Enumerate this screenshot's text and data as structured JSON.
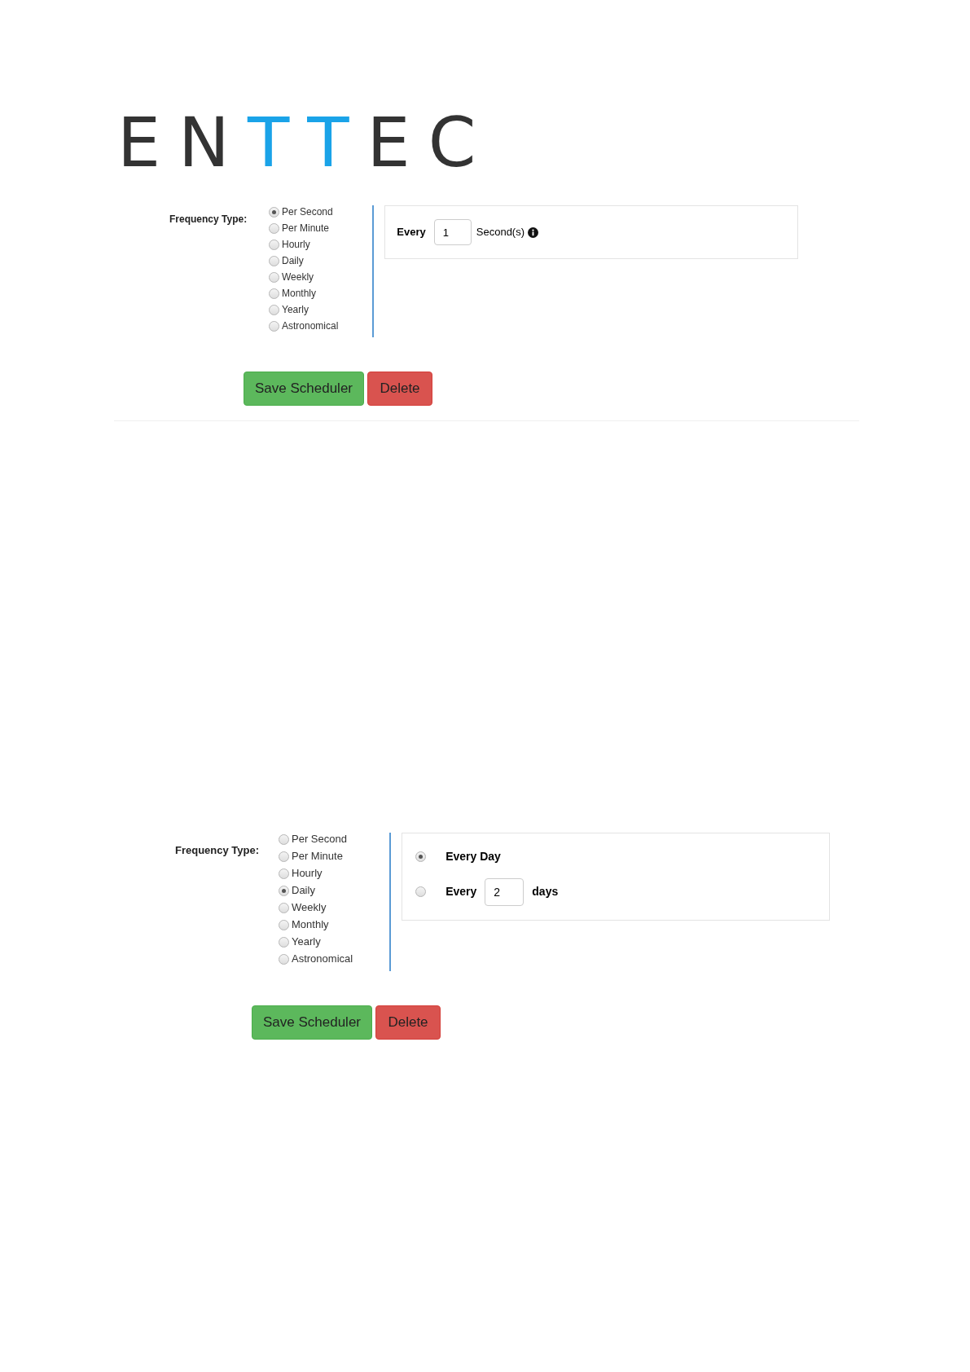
{
  "logo": [
    {
      "char": "E",
      "color": "#333333"
    },
    {
      "char": "N",
      "color": "#333333"
    },
    {
      "char": "T",
      "color": "#1aa3e8"
    },
    {
      "char": "T",
      "color": "#1aa3e8"
    },
    {
      "char": "E",
      "color": "#333333"
    },
    {
      "char": "C",
      "color": "#333333"
    }
  ],
  "schedulers": [
    {
      "frequency_label": "Frequency Type:",
      "options": [
        {
          "label": "Per Second",
          "selected": true
        },
        {
          "label": "Per Minute",
          "selected": false
        },
        {
          "label": "Hourly",
          "selected": false
        },
        {
          "label": "Daily",
          "selected": false
        },
        {
          "label": "Weekly",
          "selected": false
        },
        {
          "label": "Monthly",
          "selected": false
        },
        {
          "label": "Yearly",
          "selected": false
        },
        {
          "label": "Astronomical",
          "selected": false
        }
      ],
      "detail": {
        "kind": "interval",
        "every_label": "Every",
        "value": "1",
        "unit": "Second(s)",
        "info": true
      },
      "buttons": [
        {
          "kind": "save",
          "label": "Save Scheduler"
        },
        {
          "kind": "delete",
          "label": "Delete"
        }
      ]
    },
    {
      "frequency_label": "Frequency Type:",
      "options": [
        {
          "label": "Per Second",
          "selected": false
        },
        {
          "label": "Per Minute",
          "selected": false
        },
        {
          "label": "Hourly",
          "selected": false
        },
        {
          "label": "Daily",
          "selected": true
        },
        {
          "label": "Weekly",
          "selected": false
        },
        {
          "label": "Monthly",
          "selected": false
        },
        {
          "label": "Yearly",
          "selected": false
        },
        {
          "label": "Astronomical",
          "selected": false
        }
      ],
      "detail": {
        "kind": "choices",
        "choices": [
          {
            "kind": "plain",
            "label": "Every Day",
            "selected": true
          },
          {
            "kind": "interval",
            "label": "Every",
            "value": "2",
            "unit": "days",
            "selected": false
          }
        ]
      },
      "buttons": [
        {
          "kind": "save",
          "label": "Save Scheduler"
        },
        {
          "kind": "delete",
          "label": "Delete"
        }
      ]
    }
  ]
}
